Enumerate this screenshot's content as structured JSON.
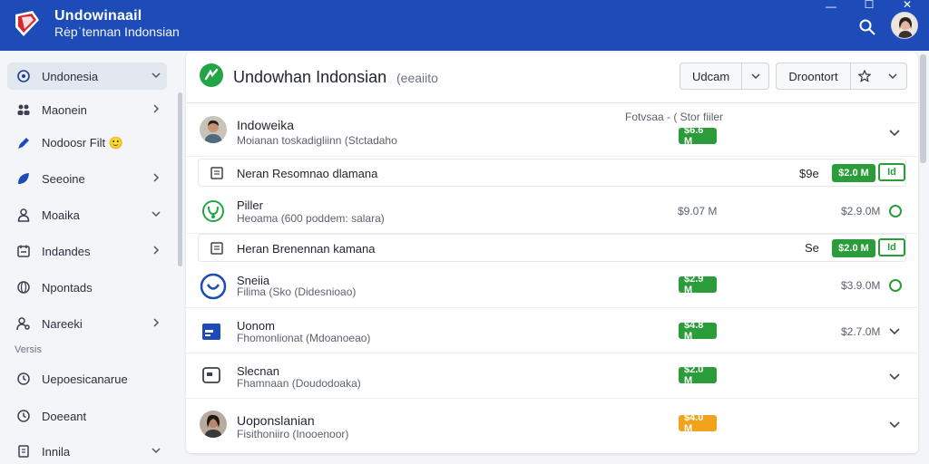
{
  "app": {
    "title": "Undowinaail",
    "subtitle": "Rėpˈtennan Indonsian"
  },
  "sidebar": {
    "section_label": "Versis",
    "items": [
      {
        "label": "Undonesia"
      },
      {
        "label": "Maonein"
      },
      {
        "label": "Nodoosr Filt 🙂"
      },
      {
        "label": "Seeoine"
      },
      {
        "label": "Moaika"
      },
      {
        "label": "Indandes"
      },
      {
        "label": "Npontads"
      },
      {
        "label": "Nareeki"
      },
      {
        "label": "Uepoesicanarue"
      },
      {
        "label": "Doeeant"
      },
      {
        "label": "Innila"
      }
    ]
  },
  "panel": {
    "title": "Undowhan Indonsian",
    "subtitle": "(eeaiito",
    "btn_primary": "Udcam",
    "btn_secondary": "Droontort",
    "top_meta": "Fotvsaa - ( Stor fiiler",
    "rows": [
      {
        "title": "Indoweika",
        "sub": "Moianan toskadigliinn (Stctadaho",
        "badge": "$6.6 M"
      },
      {
        "title": "Neran Resomnao dlamana",
        "val": "$9e",
        "badge": "$2.0 M",
        "action": "Id"
      },
      {
        "title": "Piller",
        "sub": "Heoama (600 poddem: salara)",
        "val": "$9.07 M",
        "val2": "$2.9.0M"
      },
      {
        "title": "Heran Brenennan kamana",
        "val": "Se",
        "badge": "$2.0 M",
        "action": "Id"
      },
      {
        "title": "Sneiia",
        "sub": "Filima (Sko (Didesnioao)",
        "badge": "$2.9 M",
        "val2": "$3.9.0M"
      },
      {
        "title": "Uonom",
        "sub": "Fhomonlionat (Mdoanoeao)",
        "badge": "$4.8 M",
        "val2": "$2.7.0M"
      },
      {
        "title": "Slecnan",
        "sub": "Fhamnaan (Doudodoaka)",
        "badge": "$2.0 M"
      },
      {
        "title": "Uoponslanian",
        "sub": "Fisithoniiro (Inooenoor)",
        "badge": "$4.0 M"
      }
    ]
  },
  "colors": {
    "brand": "#1d4cb8",
    "positive": "#2a9d3a",
    "warning": "#f1a31c"
  },
  "icons": [
    "logo",
    "search-icon",
    "avatar",
    "chevron-right-icon",
    "chevron-down-icon",
    "star-icon",
    "document-icon"
  ]
}
